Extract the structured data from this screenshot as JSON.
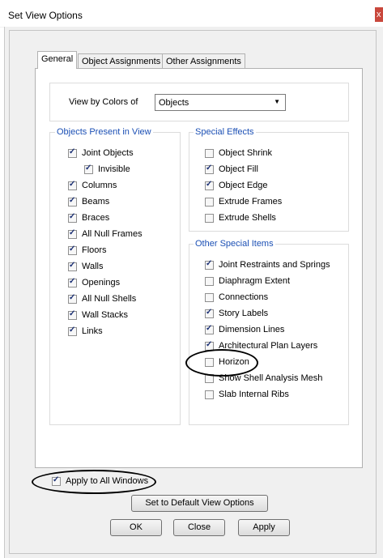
{
  "window": {
    "title": "Set View Options",
    "close_glyph": "x"
  },
  "tabs": [
    "General",
    "Object Assignments",
    "Other Assignments"
  ],
  "view_by": {
    "label": "View by Colors of",
    "value": "Objects"
  },
  "objects_present": {
    "title": "Objects Present in View",
    "items": [
      {
        "label": "Joint Objects",
        "checked": true
      },
      {
        "label": "Invisible",
        "checked": true
      },
      {
        "label": "Columns",
        "checked": true
      },
      {
        "label": "Beams",
        "checked": true
      },
      {
        "label": "Braces",
        "checked": true
      },
      {
        "label": "All Null Frames",
        "checked": true
      },
      {
        "label": "Floors",
        "checked": true
      },
      {
        "label": "Walls",
        "checked": true
      },
      {
        "label": "Openings",
        "checked": true
      },
      {
        "label": "All Null Shells",
        "checked": true
      },
      {
        "label": "Wall Stacks",
        "checked": true
      },
      {
        "label": "Links",
        "checked": true
      }
    ]
  },
  "special_effects": {
    "title": "Special Effects",
    "items": [
      {
        "label": "Object Shrink",
        "checked": false
      },
      {
        "label": "Object Fill",
        "checked": true
      },
      {
        "label": "Object Edge",
        "checked": true
      },
      {
        "label": "Extrude Frames",
        "checked": false
      },
      {
        "label": "Extrude Shells",
        "checked": false
      }
    ]
  },
  "other_special": {
    "title": "Other Special Items",
    "items": [
      {
        "label": "Joint Restraints and Springs",
        "checked": true
      },
      {
        "label": "Diaphragm Extent",
        "checked": false
      },
      {
        "label": "Connections",
        "checked": false
      },
      {
        "label": "Story Labels",
        "checked": true
      },
      {
        "label": "Dimension Lines",
        "checked": true
      },
      {
        "label": "Architectural Plan Layers",
        "checked": true
      },
      {
        "label": "Horizon",
        "checked": false
      },
      {
        "label": "Show Shell Analysis Mesh",
        "checked": false
      },
      {
        "label": "Slab Internal Ribs",
        "checked": false
      }
    ]
  },
  "apply_all": {
    "label": "Apply to All Windows",
    "checked": true
  },
  "buttons": {
    "default_label": "Set to Default View Options",
    "ok_label": "OK",
    "close_label": "Close",
    "apply_label": "Apply"
  }
}
